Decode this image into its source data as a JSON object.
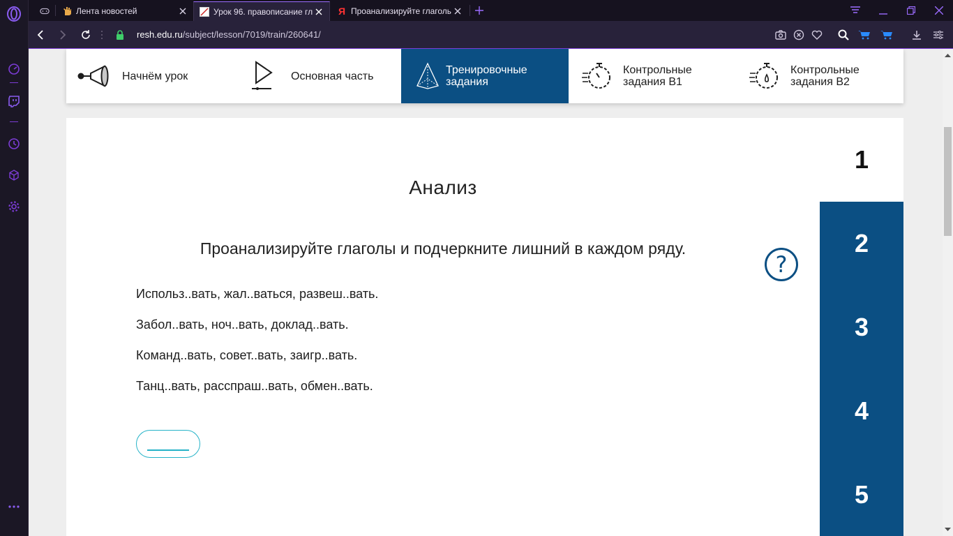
{
  "browser": {
    "tabs": [
      {
        "title": "Лента новостей",
        "active": false
      },
      {
        "title": "Урок 96. правописание гл",
        "active": true
      },
      {
        "title": "Проанализируйте глаголы",
        "active": false
      }
    ],
    "url_host": "resh.edu.ru",
    "url_path": "/subject/lesson/7019/train/260641/"
  },
  "lesson_nav": {
    "items": [
      {
        "label": "Начнём урок",
        "active": false
      },
      {
        "label": "Основная часть",
        "active": false
      },
      {
        "label": "Тренировочные задания",
        "active": true
      },
      {
        "label": "Контрольные задания В1",
        "active": false
      },
      {
        "label": "Контрольные задания В2",
        "active": false
      }
    ]
  },
  "task": {
    "title": "Анализ",
    "instruction": "Проанализируйте глаголы и подчеркните лишний в каждом ряду.",
    "help_symbol": "?",
    "lines": [
      "Использ..вать, жал..ваться, развеш..вать.",
      "Забол..вать, ноч..вать, доклад..вать.",
      "Команд..вать, совет..вать, заигр..вать.",
      "Танц..вать, расспраш..вать, обмен..вать."
    ]
  },
  "steps": [
    "1",
    "2",
    "3",
    "4",
    "5"
  ],
  "colors": {
    "accent": "#0b4f83",
    "answer_outline": "#26b3c8",
    "opera_purple": "#7c3cd6"
  }
}
